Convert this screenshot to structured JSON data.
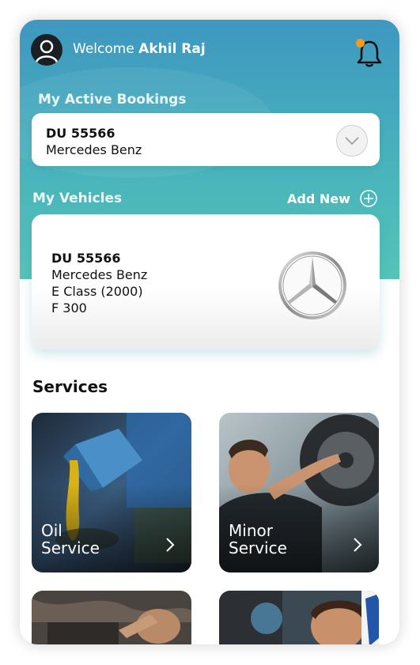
{
  "header": {
    "welcome_text": "Welcome",
    "user_name": "Akhil Raj"
  },
  "active_bookings": {
    "title": "My Active Bookings",
    "plate": "DU 55566",
    "model": "Mercedes Benz"
  },
  "vehicles": {
    "title": "My Vehicles",
    "add_new_label": "Add New",
    "card": {
      "plate": "DU 55566",
      "make": "Mercedes Benz",
      "model_year": "E Class (2000)",
      "variant": "F 300",
      "brand_logo": "mercedes-star-icon"
    }
  },
  "services": {
    "title": "Services",
    "items": [
      {
        "line1": "Oil",
        "line2": "Service"
      },
      {
        "line1": "Minor",
        "line2": "Service"
      }
    ]
  },
  "colors": {
    "header_gradient_top": "#3f97c0",
    "header_gradient_bottom": "#55c4b8",
    "notification_dot": "#f29b1e"
  }
}
